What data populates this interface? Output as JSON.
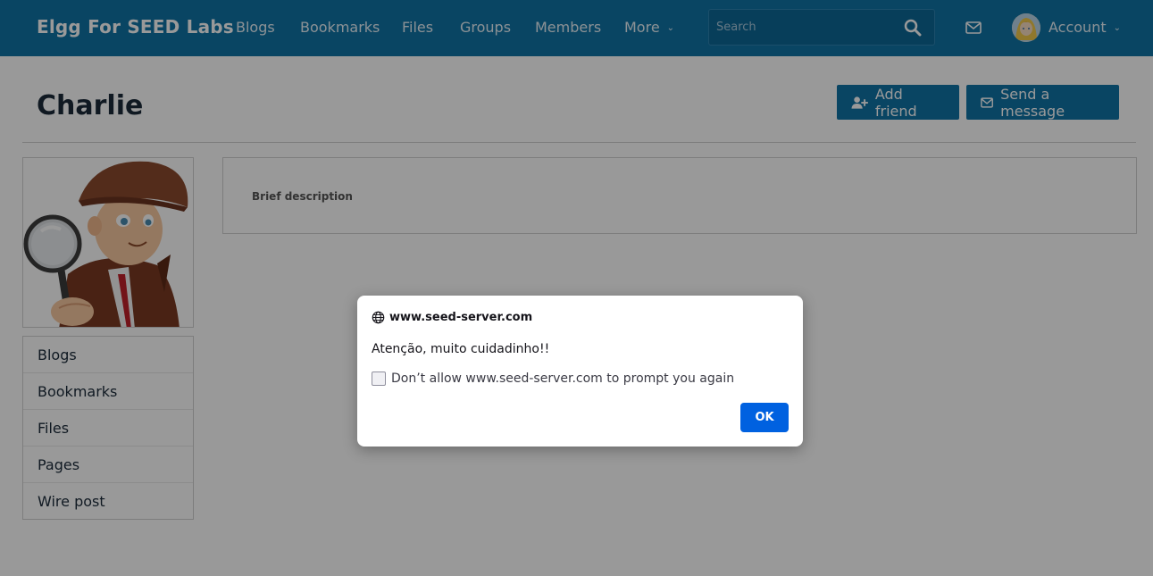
{
  "header": {
    "brand": "Elgg For SEED Labs",
    "nav": [
      {
        "label": "Blogs"
      },
      {
        "label": "Bookmarks"
      },
      {
        "label": "Files"
      },
      {
        "label": "Groups"
      },
      {
        "label": "Members"
      },
      {
        "label": "More"
      }
    ],
    "search_placeholder": "Search",
    "account_label": "Account",
    "icons": {
      "search": "search-icon",
      "mail": "envelope-icon",
      "chevron": "chevron-down-icon"
    }
  },
  "profile": {
    "name": "Charlie",
    "add_friend_label": "Add friend",
    "send_message_label": "Send a message",
    "brief_description_label": "Brief description",
    "menu": [
      {
        "label": "Blogs"
      },
      {
        "label": "Bookmarks"
      },
      {
        "label": "Files"
      },
      {
        "label": "Pages"
      },
      {
        "label": "Wire post"
      }
    ]
  },
  "dialog": {
    "origin": "www.seed-server.com",
    "message": "Atenção, muito cuidadinho!!",
    "checkbox_label": "Don’t allow www.seed-server.com to prompt you again",
    "checkbox_checked": false,
    "ok_label": "OK"
  },
  "colors": {
    "header_bg": "#0f73a6",
    "button_bg": "#0f73a6",
    "dialog_ok": "#0061e0"
  }
}
